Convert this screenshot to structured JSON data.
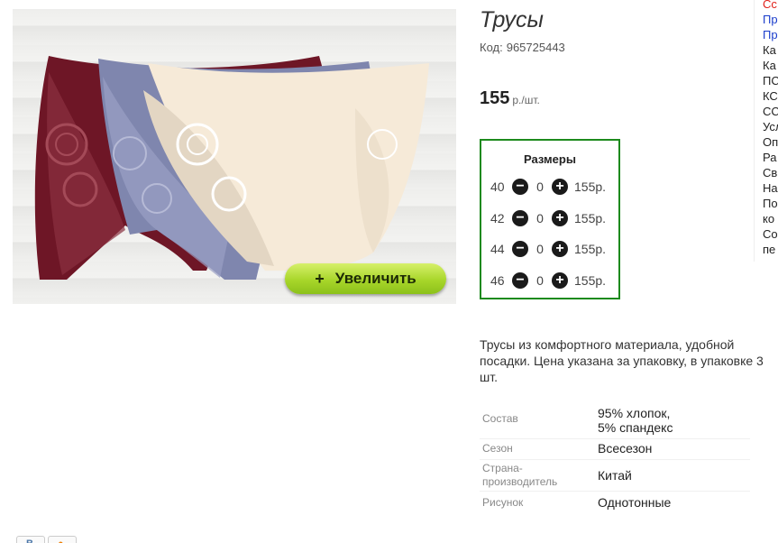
{
  "product": {
    "title": "Трусы",
    "code_label": "Код:",
    "code": "965725443",
    "price": "155",
    "price_unit": "р./шт.",
    "zoom_label": "Увеличить",
    "zoom_plus": "+",
    "description": "Трусы из комфортного материала, удобной посадки. Цена указана за упаковку, в упаковке 3 шт."
  },
  "sizes": {
    "title": "Размеры",
    "rows": [
      {
        "size": "40",
        "qty": "0",
        "price": "155р."
      },
      {
        "size": "42",
        "qty": "0",
        "price": "155р."
      },
      {
        "size": "44",
        "qty": "0",
        "price": "155р."
      },
      {
        "size": "46",
        "qty": "0",
        "price": "155р."
      }
    ]
  },
  "specs": [
    {
      "label": "Состав",
      "value_line1": "95% хлопок,",
      "value_line2": "5% спандекс"
    },
    {
      "label": "Сезон",
      "value_line1": "Всесезон"
    },
    {
      "label_line1": "Страна-",
      "label_line2": "производитель",
      "value_line1": "Китай"
    },
    {
      "label": "Рисунок",
      "value_line1": "Однотонные"
    }
  ],
  "side_links": [
    "Сс",
    "Пр",
    "Пр",
    "Ка",
    "Ка",
    "ПС",
    "КС",
    "СС",
    "Усл",
    "Оп",
    "Ра",
    "Св",
    "На",
    "По",
    "ко",
    "Со",
    "пе"
  ],
  "colors": {
    "sizes_border": "#1d8a1d",
    "zoom_button": "#a8d62a",
    "link_blue": "#1a3dcc",
    "link_red": "#e0201a"
  }
}
